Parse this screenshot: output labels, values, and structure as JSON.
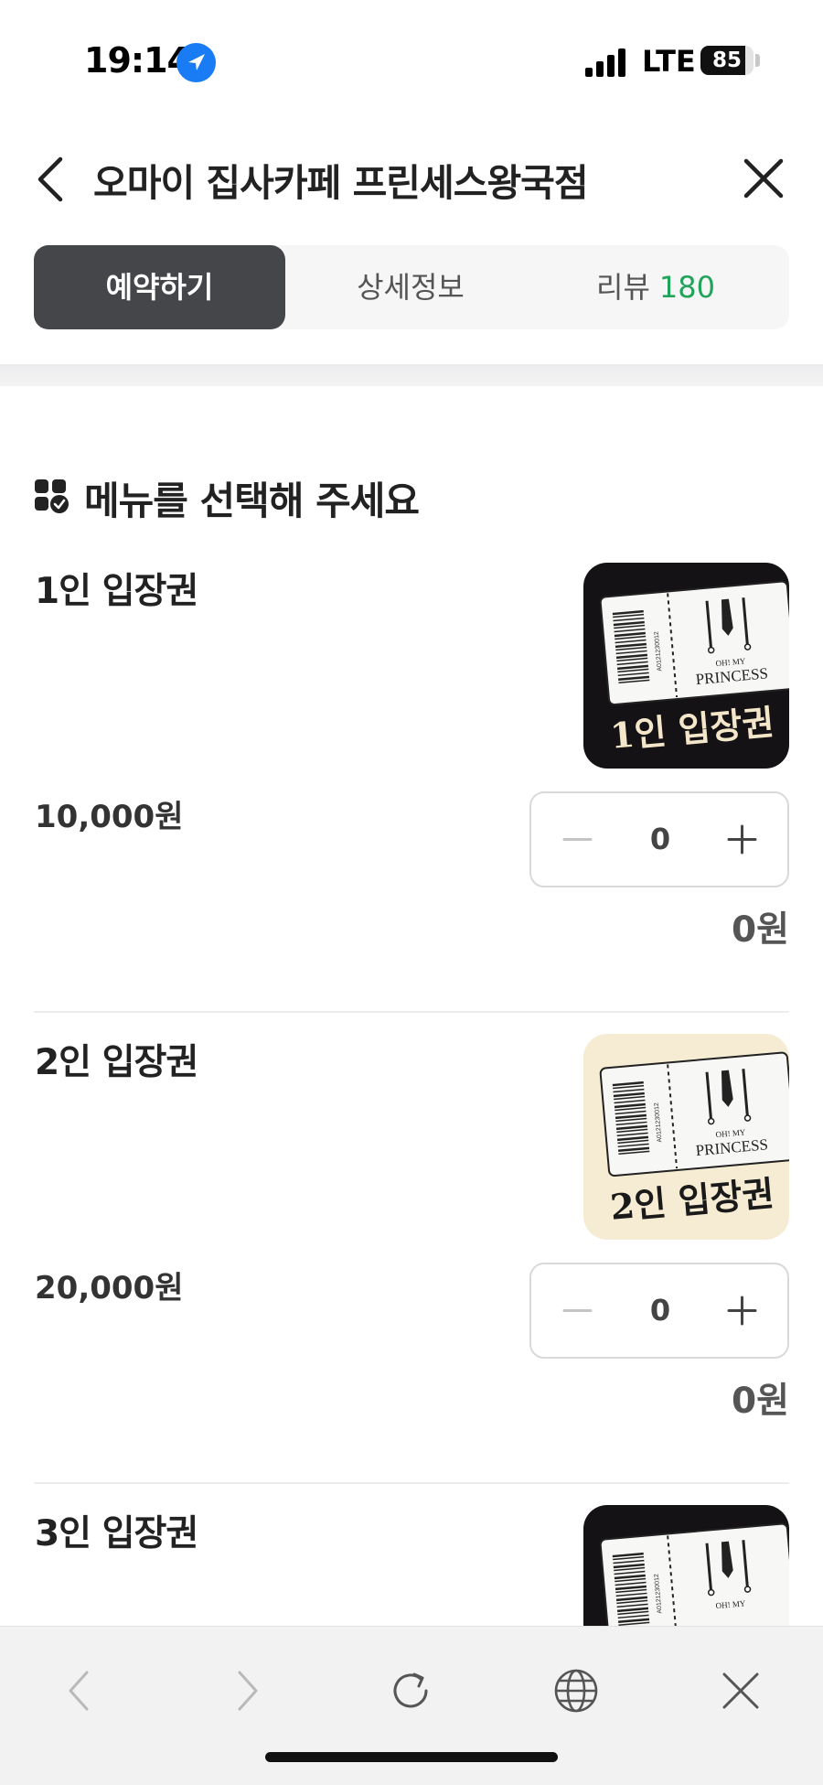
{
  "status_bar": {
    "time": "19:14",
    "network": "LTE",
    "battery": "85",
    "battery_level": 0.85
  },
  "header": {
    "title": "오마이 집사카페 프린세스왕국점"
  },
  "tabs": [
    {
      "label": "예약하기",
      "active": true
    },
    {
      "label": "상세정보",
      "active": false
    },
    {
      "label": "리뷰",
      "count": "180",
      "active": false
    }
  ],
  "section": {
    "title": "메뉴를 선택해 주세요"
  },
  "menu_items": [
    {
      "name": "1인 입장권",
      "price": "10,000원",
      "quantity": "0",
      "total": "0원",
      "thumb_bg": "#141214",
      "thumb_label": "1인 입장권",
      "thumb_label_color": "#f3e6c9",
      "ticket_brand_top": "OH! MY",
      "ticket_brand": "PRINCESS",
      "ticket_serial": "A0121230012"
    },
    {
      "name": "2인 입장권",
      "price": "20,000원",
      "quantity": "0",
      "total": "0원",
      "thumb_bg": "#f5ecd3",
      "thumb_label": "2인 입장권",
      "thumb_label_color": "#1a1a1a",
      "ticket_brand_top": "OH! MY",
      "ticket_brand": "PRINCESS",
      "ticket_serial": "A0121230012"
    },
    {
      "name": "3인 입장권",
      "thumb_bg": "#141214",
      "ticket_brand_top": "OH! MY",
      "ticket_serial": "A0121230012"
    }
  ],
  "browser_toolbar": {
    "buttons": [
      "back-icon",
      "forward-icon",
      "reload-icon",
      "globe-icon",
      "close-icon"
    ]
  },
  "colors": {
    "accent_green": "#21a35a",
    "tab_active_bg": "#45464a",
    "location_blue": "#1a7cf5"
  }
}
